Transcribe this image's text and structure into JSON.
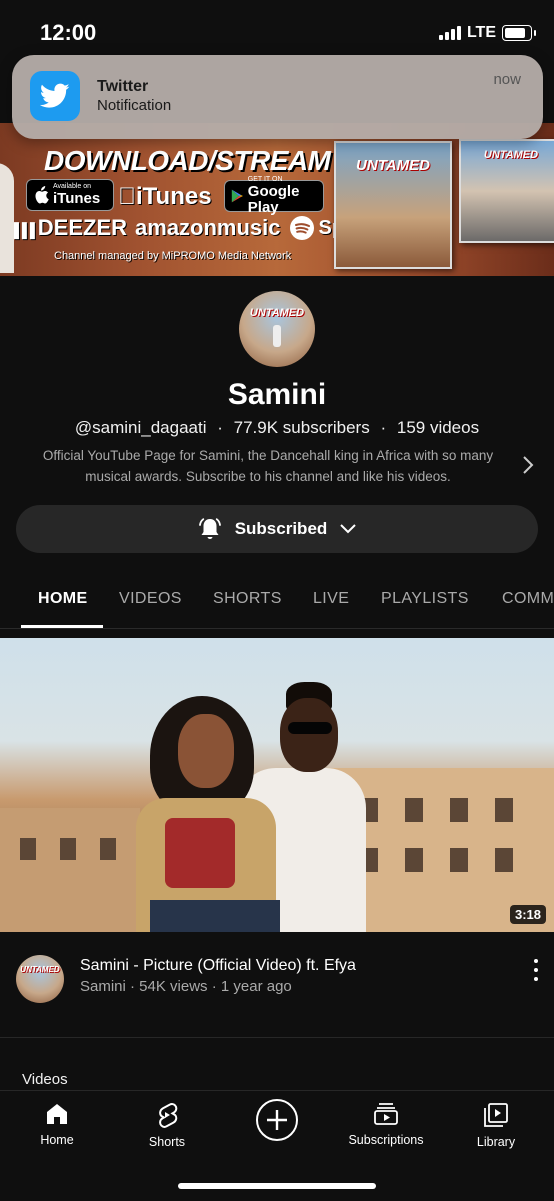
{
  "status_bar": {
    "time": "12:00",
    "network": "LTE"
  },
  "notification": {
    "app": "Twitter",
    "body": "Notification",
    "time": "now",
    "icon": "twitter-bird-icon"
  },
  "banner": {
    "headline": "DOWNLOAD/STREAM",
    "itunes_badge_small": "Available on",
    "itunes_badge_big": "iTunes",
    "itunes_text": "iTunes",
    "google_badge_small": "GET IT ON",
    "google_badge_big": "Google Play",
    "deezer": "DEEZER",
    "amazon": "amazonmusic",
    "spotify": "Spotify",
    "managed": "Channel managed by MiPROMO Media Network",
    "album_title": "UNTAMED"
  },
  "channel": {
    "name": "Samini",
    "handle": "@samini_dagaati",
    "subscribers": "77.9K subscribers",
    "videos": "159 videos",
    "separator": "·",
    "description": "Official YouTube Page for Samini, the Dancehall king in Africa with so many musical awards. Subscribe to his channel and like his videos.",
    "subscribe_label": "Subscribed"
  },
  "tabs": [
    "HOME",
    "VIDEOS",
    "SHORTS",
    "LIVE",
    "PLAYLISTS",
    "COMM"
  ],
  "featured_video": {
    "title": "Samini - Picture (Official Video) ft. Efya",
    "meta": "Samini · 54K views · 1 year ago",
    "duration": "3:18"
  },
  "section_label": "Videos",
  "bottom_nav": {
    "home": "Home",
    "shorts": "Shorts",
    "subscriptions": "Subscriptions",
    "library": "Library"
  },
  "colors": {
    "background": "#0f0f0f",
    "twitter_blue": "#1d9bf0",
    "secondary_text": "#aaaaaa"
  }
}
